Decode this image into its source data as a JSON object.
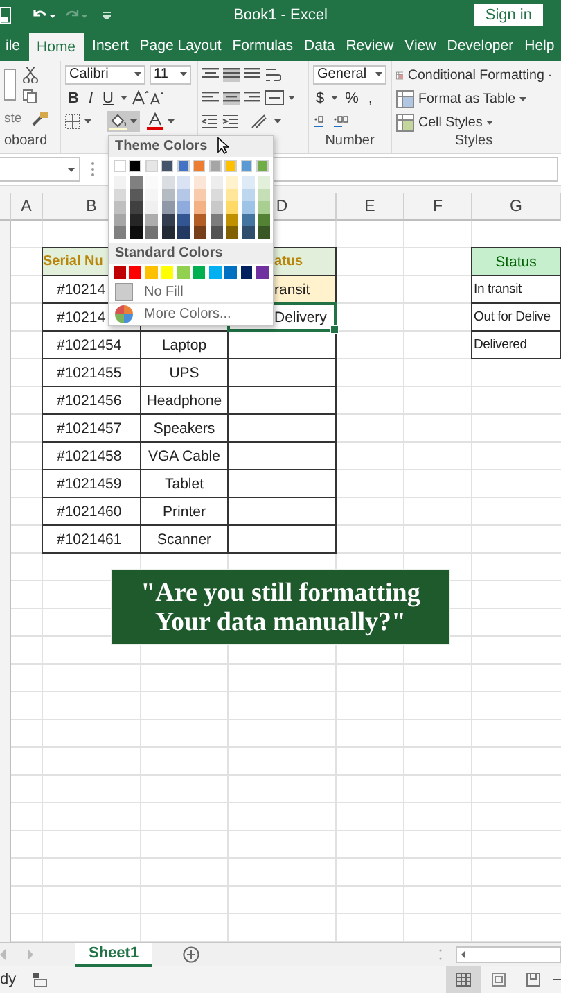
{
  "window": {
    "title": "Book1  -  Excel",
    "sign_in": "Sign in"
  },
  "tabs": [
    {
      "label": "ile",
      "selected": false
    },
    {
      "label": "Home",
      "selected": true
    },
    {
      "label": "Insert",
      "selected": false
    },
    {
      "label": "Page Layout",
      "selected": false
    },
    {
      "label": "Formulas",
      "selected": false
    },
    {
      "label": "Data",
      "selected": false
    },
    {
      "label": "Review",
      "selected": false
    },
    {
      "label": "View",
      "selected": false
    },
    {
      "label": "Developer",
      "selected": false
    },
    {
      "label": "Help",
      "selected": false
    }
  ],
  "ribbon": {
    "clipboard": {
      "paste": "ste",
      "label": "oboard"
    },
    "font": {
      "name": "Calibri",
      "size": "11",
      "styles": [
        "B",
        "I",
        "U"
      ]
    },
    "number": {
      "format": "General",
      "buttons": [
        "$",
        "%",
        ","
      ],
      "label": "Number"
    },
    "styles": {
      "items": [
        "Conditional Formatting",
        "Format as Table",
        "Cell Styles"
      ],
      "label": "Styles"
    }
  },
  "color_menu": {
    "theme_title": "Theme Colors",
    "theme_colors": [
      {
        "color": "#ffffff"
      },
      {
        "color": "#000000"
      },
      {
        "color": "#e7e6e6"
      },
      {
        "color": "#44546a"
      },
      {
        "color": "#4472c4"
      },
      {
        "color": "#ed7d31"
      },
      {
        "color": "#a5a5a5"
      },
      {
        "color": "#ffc000"
      },
      {
        "color": "#5b9bd5"
      },
      {
        "color": "#70ad47"
      }
    ],
    "standard_title": "Standard Colors",
    "standard_colors": [
      {
        "color": "#c00000"
      },
      {
        "color": "#ff0000"
      },
      {
        "color": "#ffc000"
      },
      {
        "color": "#ffff00"
      },
      {
        "color": "#92d050"
      },
      {
        "color": "#00b050"
      },
      {
        "color": "#00b0f0"
      },
      {
        "color": "#0070c0"
      },
      {
        "color": "#002060"
      },
      {
        "color": "#7030a0"
      }
    ],
    "no_fill": "No Fill",
    "more_colors": "More Colors..."
  },
  "sheet": {
    "columns": [
      {
        "label": "A"
      },
      {
        "label": "B"
      },
      {},
      {
        "label": "D"
      },
      {
        "label": "E"
      },
      {
        "label": "F"
      },
      {
        "label": "G"
      }
    ],
    "rows": [
      {},
      {
        "B": {
          "text": "Serial Nu",
          "kind": "header",
          "selected": false
        },
        "D": {
          "text": "atus",
          "kind": "header",
          "selected": false
        },
        "G": {
          "text": "Status",
          "kind": "status_header",
          "selected": false
        }
      },
      {
        "B": {
          "text": "#10214",
          "kind": "item",
          "selected": false
        },
        "D": {
          "text": "ransit",
          "kind": "fill",
          "selected": false
        },
        "G": {
          "text": "In transit",
          "kind": "list",
          "selected": false
        }
      },
      {
        "B": {
          "text": "#10214",
          "kind": "item",
          "selected": false
        },
        "D": {
          "text": "Delivery",
          "kind": "item",
          "selected": true
        },
        "G": {
          "text": "Out for Delive",
          "kind": "list",
          "selected": false
        }
      },
      {
        "B": {
          "text": "#1021454",
          "kind": "item",
          "selected": false
        },
        "C": {
          "text": "Laptop",
          "kind": "item",
          "selected": false
        },
        "D": {
          "kind": "item",
          "selected": false
        },
        "G": {
          "text": "Delivered",
          "kind": "list",
          "selected": false
        }
      },
      {
        "B": {
          "text": "#1021455",
          "kind": "item",
          "selected": false
        },
        "C": {
          "text": "UPS",
          "kind": "item",
          "selected": false
        },
        "D": {
          "kind": "item",
          "selected": false
        }
      },
      {
        "B": {
          "text": "#1021456",
          "kind": "item",
          "selected": false
        },
        "C": {
          "text": "Headphone",
          "kind": "item",
          "selected": false
        },
        "D": {
          "kind": "item",
          "selected": false
        }
      },
      {
        "B": {
          "text": "#1021457",
          "kind": "item",
          "selected": false
        },
        "C": {
          "text": "Speakers",
          "kind": "item",
          "selected": false
        },
        "D": {
          "kind": "item",
          "selected": false
        }
      },
      {
        "B": {
          "text": "#1021458",
          "kind": "item",
          "selected": false
        },
        "C": {
          "text": "VGA Cable",
          "kind": "item",
          "selected": false
        },
        "D": {
          "kind": "item",
          "selected": false
        }
      },
      {
        "B": {
          "text": "#1021459",
          "kind": "item",
          "selected": false
        },
        "C": {
          "text": "Tablet",
          "kind": "item",
          "selected": false
        },
        "D": {
          "kind": "item",
          "selected": false
        }
      },
      {
        "B": {
          "text": "#1021460",
          "kind": "item",
          "selected": false
        },
        "C": {
          "text": "Printer",
          "kind": "item",
          "selected": false
        },
        "D": {
          "kind": "item",
          "selected": false
        }
      },
      {
        "B": {
          "text": "#1021461",
          "kind": "item",
          "selected": false
        },
        "C": {
          "text": "Scanner",
          "kind": "item",
          "selected": false
        },
        "D": {
          "kind": "item",
          "selected": false
        }
      }
    ]
  },
  "caption": {
    "lines": [
      "\"Are you still formatting",
      "Your data manually?\""
    ]
  },
  "sheet_tabs": [
    {
      "label": "Sheet1",
      "selected": true
    }
  ],
  "status_bar": {
    "text": "dy"
  }
}
